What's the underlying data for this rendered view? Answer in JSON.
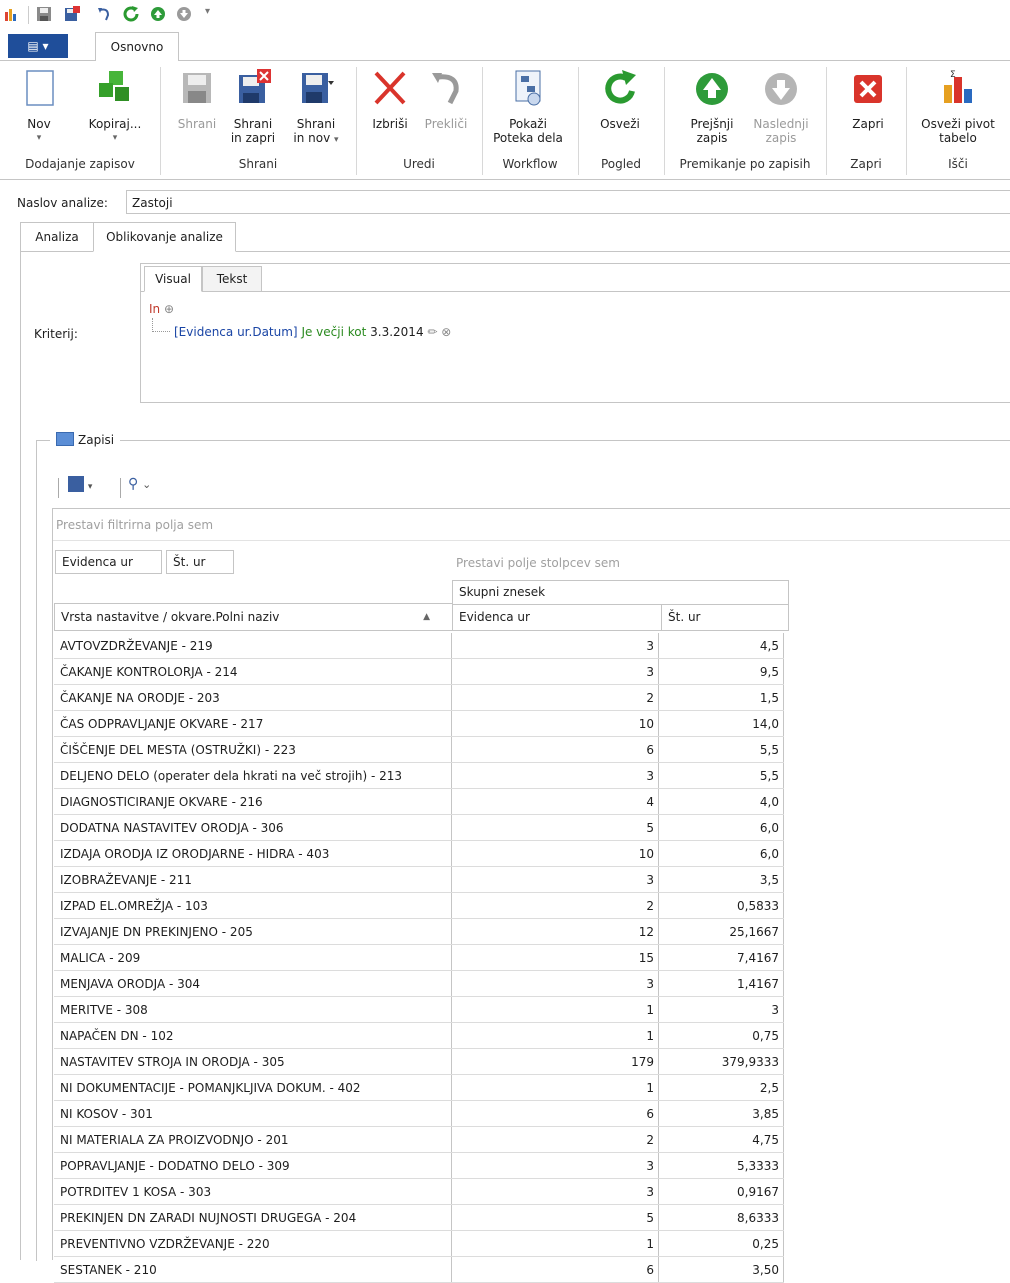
{
  "colors": {
    "file_tab": "#1f4e9a",
    "criteria_field": "#1a45a5",
    "criteria_op": "#2a8a1f",
    "criteria_in": "#c0392b"
  },
  "tabs": {
    "file_label": "",
    "active": "Osnovno"
  },
  "ribbon": {
    "groups": [
      {
        "label": "Dodajanje zapisov"
      },
      {
        "label": "Shrani"
      },
      {
        "label": "Uredi"
      },
      {
        "label": "Workflow"
      },
      {
        "label": "Pogled"
      },
      {
        "label": "Premikanje po zapisih"
      },
      {
        "label": "Zapri"
      },
      {
        "label": "Išči"
      }
    ],
    "buttons": {
      "nov": {
        "l1": "Nov",
        "l2": ""
      },
      "kopiraj": {
        "l1": "Kopiraj...",
        "l2": ""
      },
      "shrani": {
        "l1": "Shrani",
        "l2": ""
      },
      "shrani_zapri": {
        "l1": "Shrani",
        "l2": "in zapri"
      },
      "shrani_nov": {
        "l1": "Shrani",
        "l2": "in nov"
      },
      "izbrisi": {
        "l1": "Izbriši",
        "l2": ""
      },
      "preklici": {
        "l1": "Prekliči",
        "l2": ""
      },
      "pokazi": {
        "l1": "Pokaži",
        "l2": "Poteka dela"
      },
      "osvezi": {
        "l1": "Osveži",
        "l2": ""
      },
      "prejsnji": {
        "l1": "Prejšnji",
        "l2": "zapis"
      },
      "naslednji": {
        "l1": "Naslednji",
        "l2": "zapis"
      },
      "zapri": {
        "l1": "Zapri",
        "l2": ""
      },
      "osvezi_pivot": {
        "l1": "Osveži pivot",
        "l2": "tabelo"
      }
    }
  },
  "form": {
    "naslov_label": "Naslov analize:",
    "naslov_value": "Zastoji",
    "tab_analiza": "Analiza",
    "tab_oblikovanje": "Oblikovanje analize",
    "kriterij_label": "Kriterij:",
    "tab_visual": "Visual",
    "tab_tekst": "Tekst",
    "crit_in": "In",
    "crit_field": "[Evidenca ur.Datum]",
    "crit_op": "Je večji kot",
    "crit_value": "3.3.2014"
  },
  "zapisi": {
    "title": "Zapisi",
    "filter_placeholder": "Prestavi filtrirna polja sem",
    "data_fields": [
      "Evidenca ur",
      "Št. ur"
    ],
    "column_placeholder": "Prestavi polje stolpcev sem",
    "group_header": "Skupni znesek",
    "row_header": "Vrsta nastavitve / okvare.Polni naziv",
    "columns": [
      "Evidenca ur",
      "Št. ur"
    ],
    "rows": [
      [
        "AVTOVZDRŽEVANJE - 219",
        "3",
        "4,5"
      ],
      [
        "ČAKANJE KONTROLORJA - 214",
        "3",
        "9,5"
      ],
      [
        "ČAKANJE NA ORODJE - 203",
        "2",
        "1,5"
      ],
      [
        "ČAS ODPRAVLJANJE OKVARE - 217",
        "10",
        "14,0"
      ],
      [
        "ČIŠČENJE DEL MESTA (OSTRUŽKI) - 223",
        "6",
        "5,5"
      ],
      [
        "DELJENO DELO (operater dela hkrati na več strojih) - 213",
        "3",
        "5,5"
      ],
      [
        "DIAGNOSTICIRANJE OKVARE - 216",
        "4",
        "4,0"
      ],
      [
        "DODATNA NASTAVITEV ORODJA - 306",
        "5",
        "6,0"
      ],
      [
        "IZDAJA ORODJA IZ ORODJARNE - HIDRA - 403",
        "10",
        "6,0"
      ],
      [
        "IZOBRAŽEVANJE - 211",
        "3",
        "3,5"
      ],
      [
        "IZPAD EL.OMREŽJA - 103",
        "2",
        "0,5833"
      ],
      [
        "IZVAJANJE DN PREKINJENO - 205",
        "12",
        "25,1667"
      ],
      [
        "MALICA - 209",
        "15",
        "7,4167"
      ],
      [
        "MENJAVA ORODJA - 304",
        "3",
        "1,4167"
      ],
      [
        "MERITVE - 308",
        "1",
        "3"
      ],
      [
        "NAPAČEN DN - 102",
        "1",
        "0,75"
      ],
      [
        "NASTAVITEV STROJA IN ORODJA - 305",
        "179",
        "379,9333"
      ],
      [
        "NI DOKUMENTACIJE - POMANJKLJIVA DOKUM. - 402",
        "1",
        "2,5"
      ],
      [
        "NI KOSOV - 301",
        "6",
        "3,85"
      ],
      [
        "NI MATERIALA ZA PROIZVODNJO - 201",
        "2",
        "4,75"
      ],
      [
        "POPRAVLJANJE - DODATNO DELO - 309",
        "3",
        "5,3333"
      ],
      [
        "POTRDITEV 1 KOSA - 303",
        "3",
        "0,9167"
      ],
      [
        "PREKINJEN DN ZARADI NUJNOSTI DRUGEGA - 204",
        "5",
        "8,6333"
      ],
      [
        "PREVENTIVNO VZDRŽEVANJE - 220",
        "1",
        "0,25"
      ],
      [
        "SESTANEK - 210",
        "6",
        "3,50"
      ]
    ]
  }
}
